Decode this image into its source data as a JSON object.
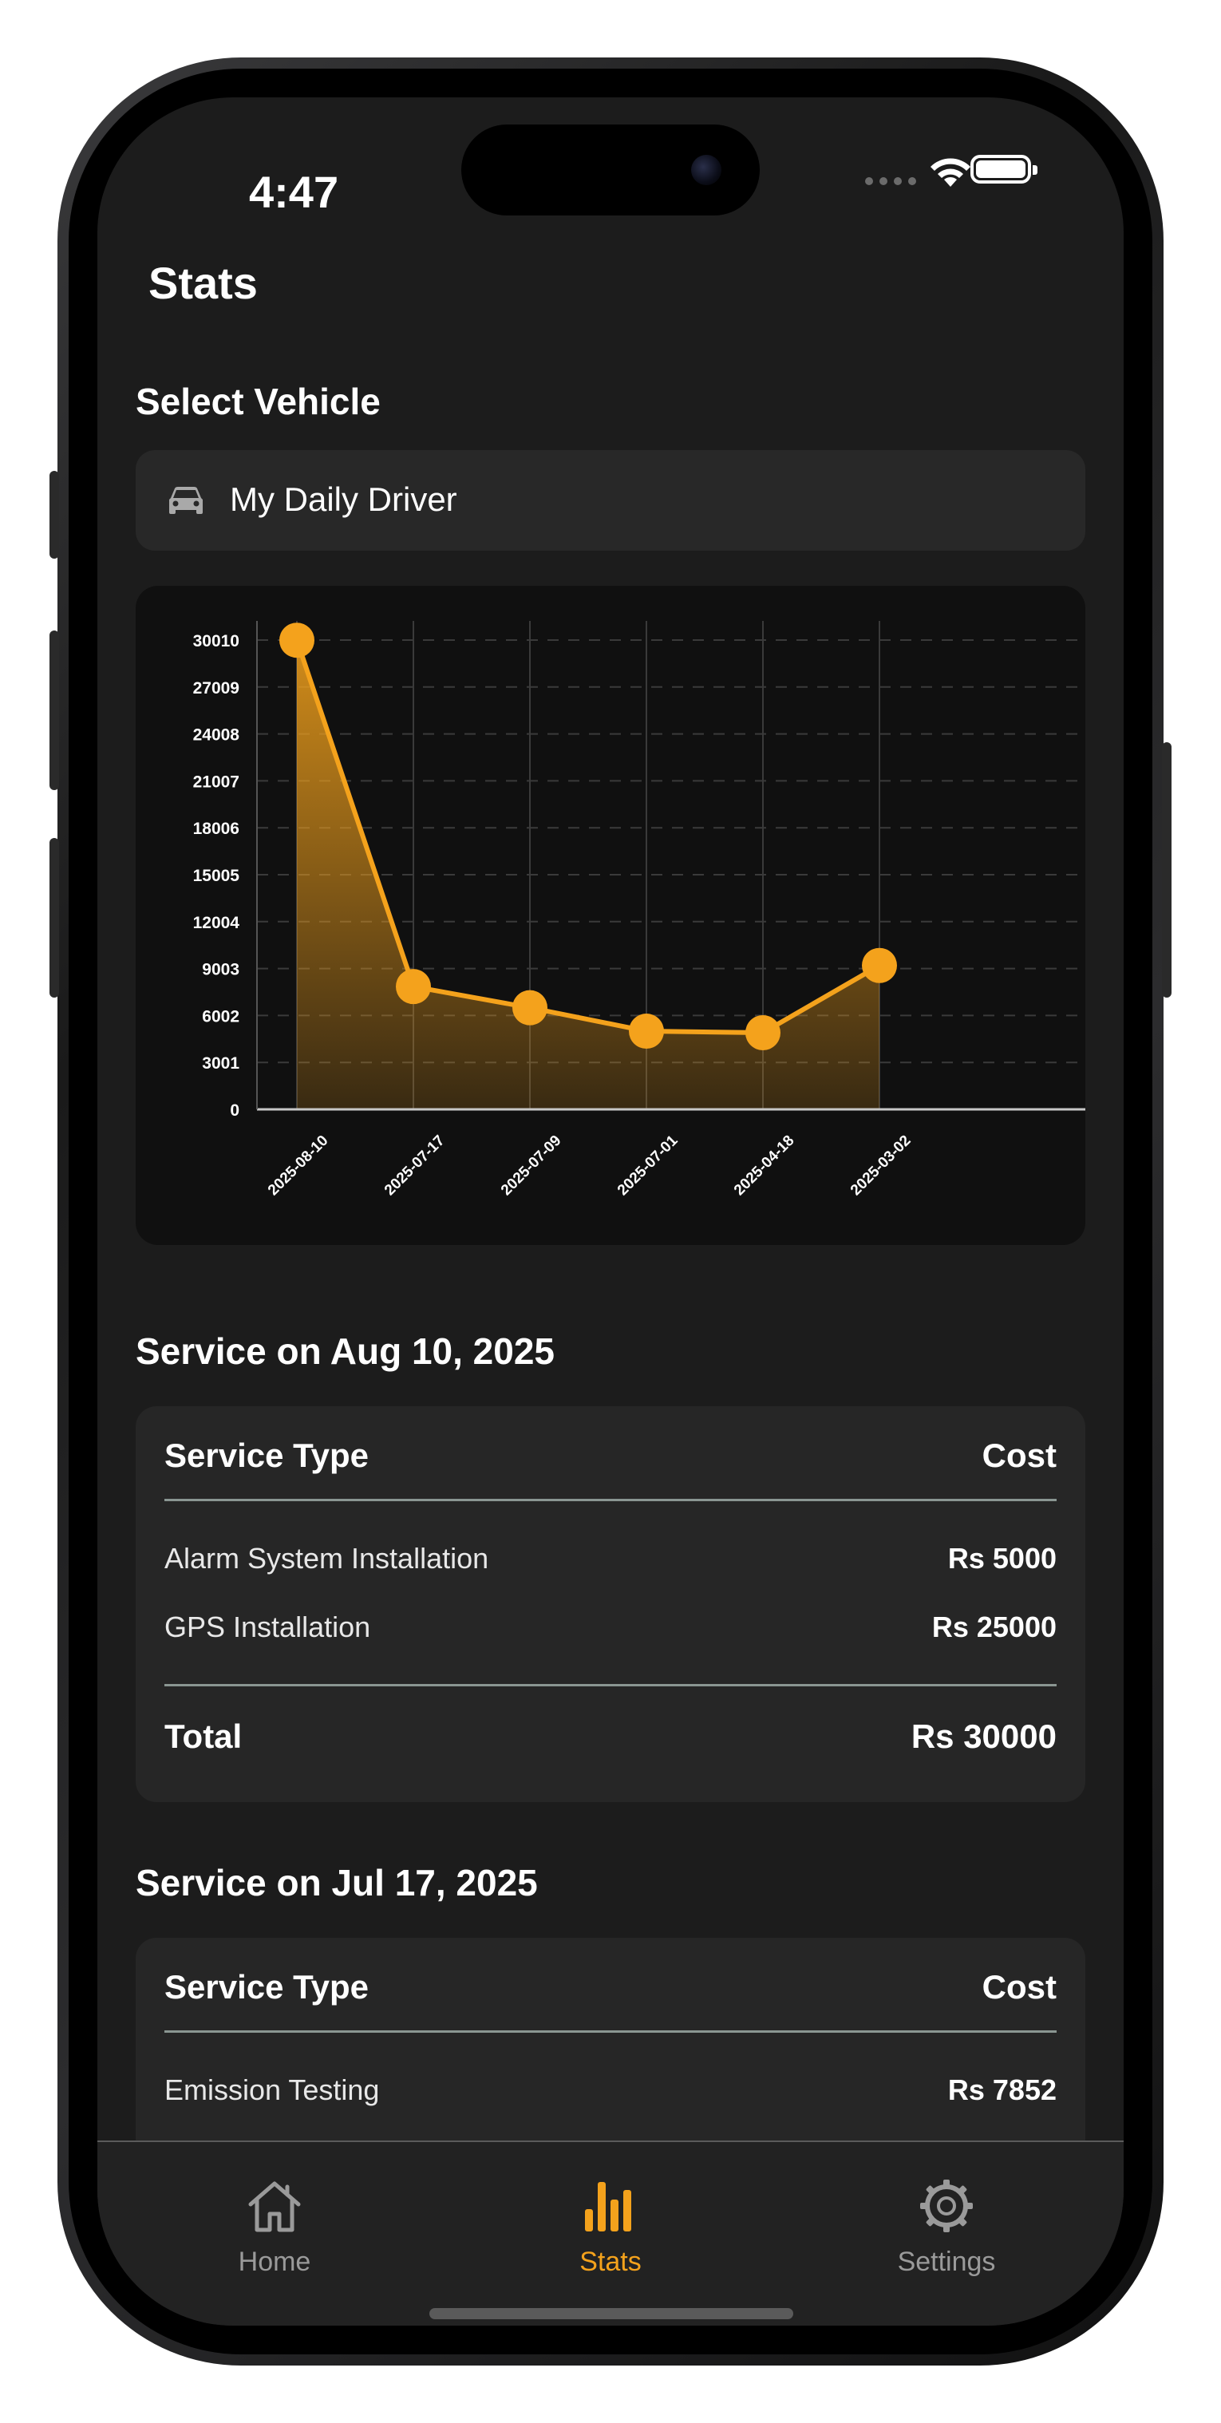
{
  "status_bar": {
    "time": "4:47"
  },
  "page": {
    "title": "Stats"
  },
  "vehicle_select": {
    "label": "Select Vehicle",
    "value": "My Daily Driver",
    "icon": "car-icon"
  },
  "colors": {
    "accent": "#f4a21c",
    "background": "#1c1c1c",
    "card": "#262626"
  },
  "chart_data": {
    "type": "area",
    "x": [
      "2025-08-10",
      "2025-07-17",
      "2025-07-09",
      "2025-07-01",
      "2025-04-18",
      "2025-03-02"
    ],
    "values": [
      30000,
      7852,
      6500,
      5000,
      4900,
      9200
    ],
    "y_ticks": [
      "0",
      "3001",
      "6002",
      "9003",
      "12004",
      "15005",
      "18006",
      "21007",
      "24008",
      "27009",
      "30010"
    ],
    "ylim": [
      0,
      30010
    ],
    "grid": true,
    "color": "#f4a21c"
  },
  "services": [
    {
      "title": "Service on Aug 10, 2025",
      "header_type": "Service Type",
      "header_cost": "Cost",
      "items": [
        {
          "name": "Alarm System Installation",
          "cost": "Rs 5000"
        },
        {
          "name": "GPS Installation",
          "cost": "Rs 25000"
        }
      ],
      "total_label": "Total",
      "total": "Rs 30000"
    },
    {
      "title": "Service on Jul 17, 2025",
      "header_type": "Service Type",
      "header_cost": "Cost",
      "items": [
        {
          "name": "Emission Testing",
          "cost": "Rs 7852"
        }
      ]
    }
  ],
  "tabs": [
    {
      "label": "Home",
      "icon": "home-icon",
      "active": false
    },
    {
      "label": "Stats",
      "icon": "bar-chart-icon",
      "active": true
    },
    {
      "label": "Settings",
      "icon": "gear-icon",
      "active": false
    }
  ]
}
